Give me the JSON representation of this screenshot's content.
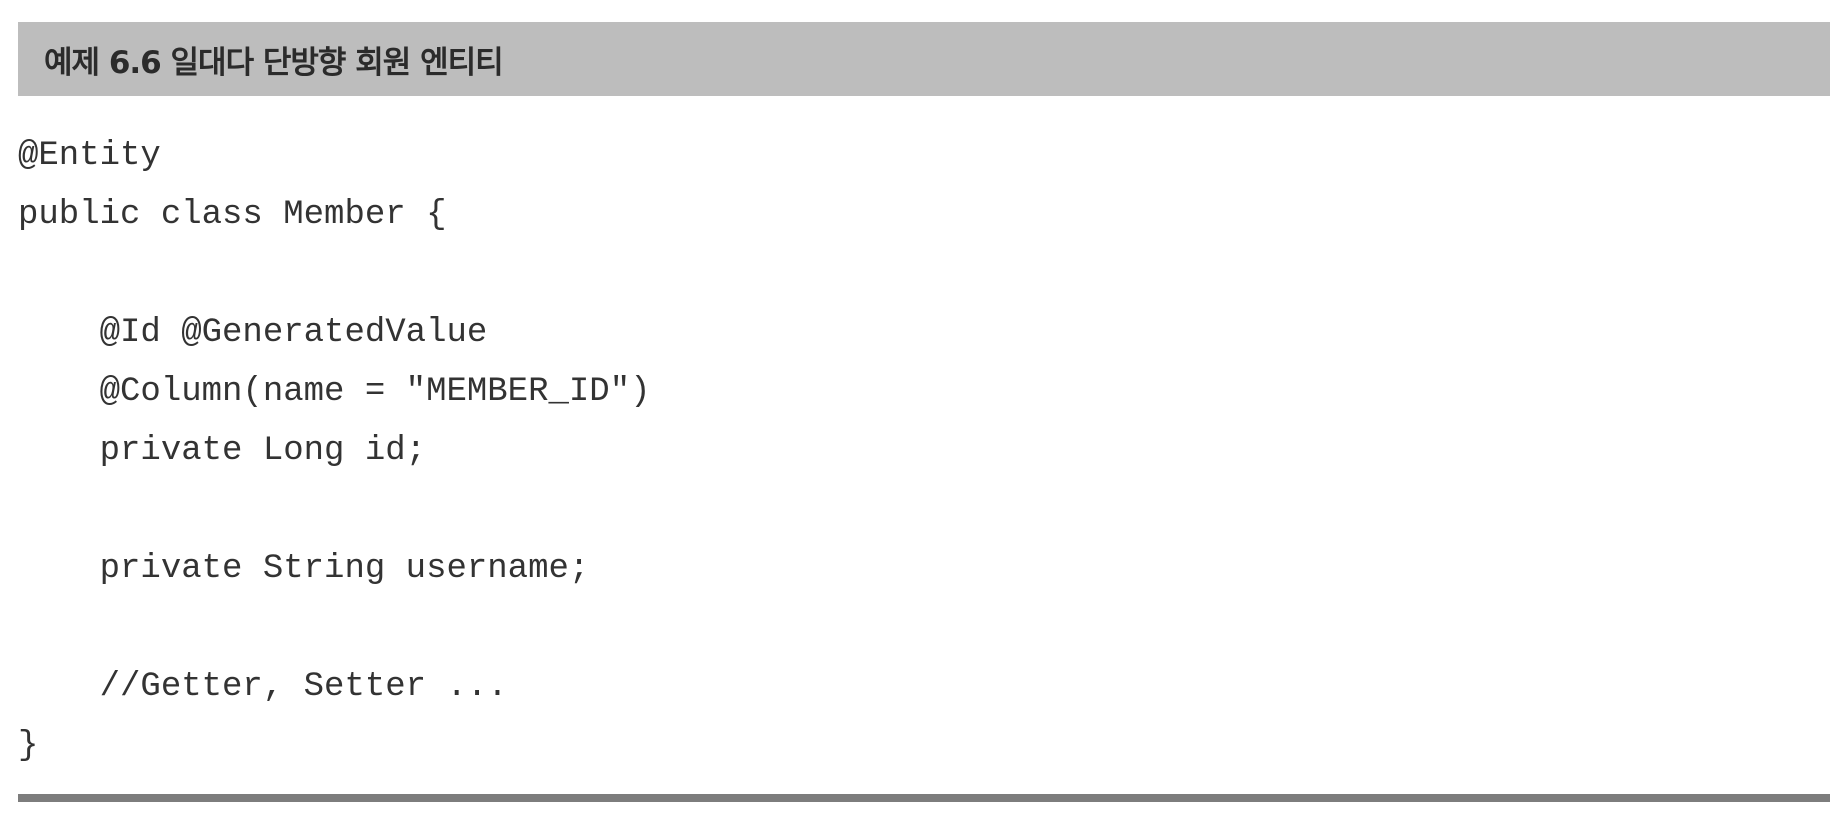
{
  "listing": {
    "title": "예제 6.6 일대다 단방향 회원 엔티티",
    "code_lines": [
      "@Entity",
      "public class Member {",
      "",
      "    @Id @GeneratedValue",
      "    @Column(name = \"MEMBER_ID\")",
      "    private Long id;",
      "",
      "    private String username;",
      "",
      "    //Getter, Setter ...",
      "}"
    ]
  },
  "colors": {
    "header_background": "#bdbdbd",
    "title_text": "#2b2b2b",
    "code_text": "#333333",
    "rule": "#7d7d7d"
  }
}
